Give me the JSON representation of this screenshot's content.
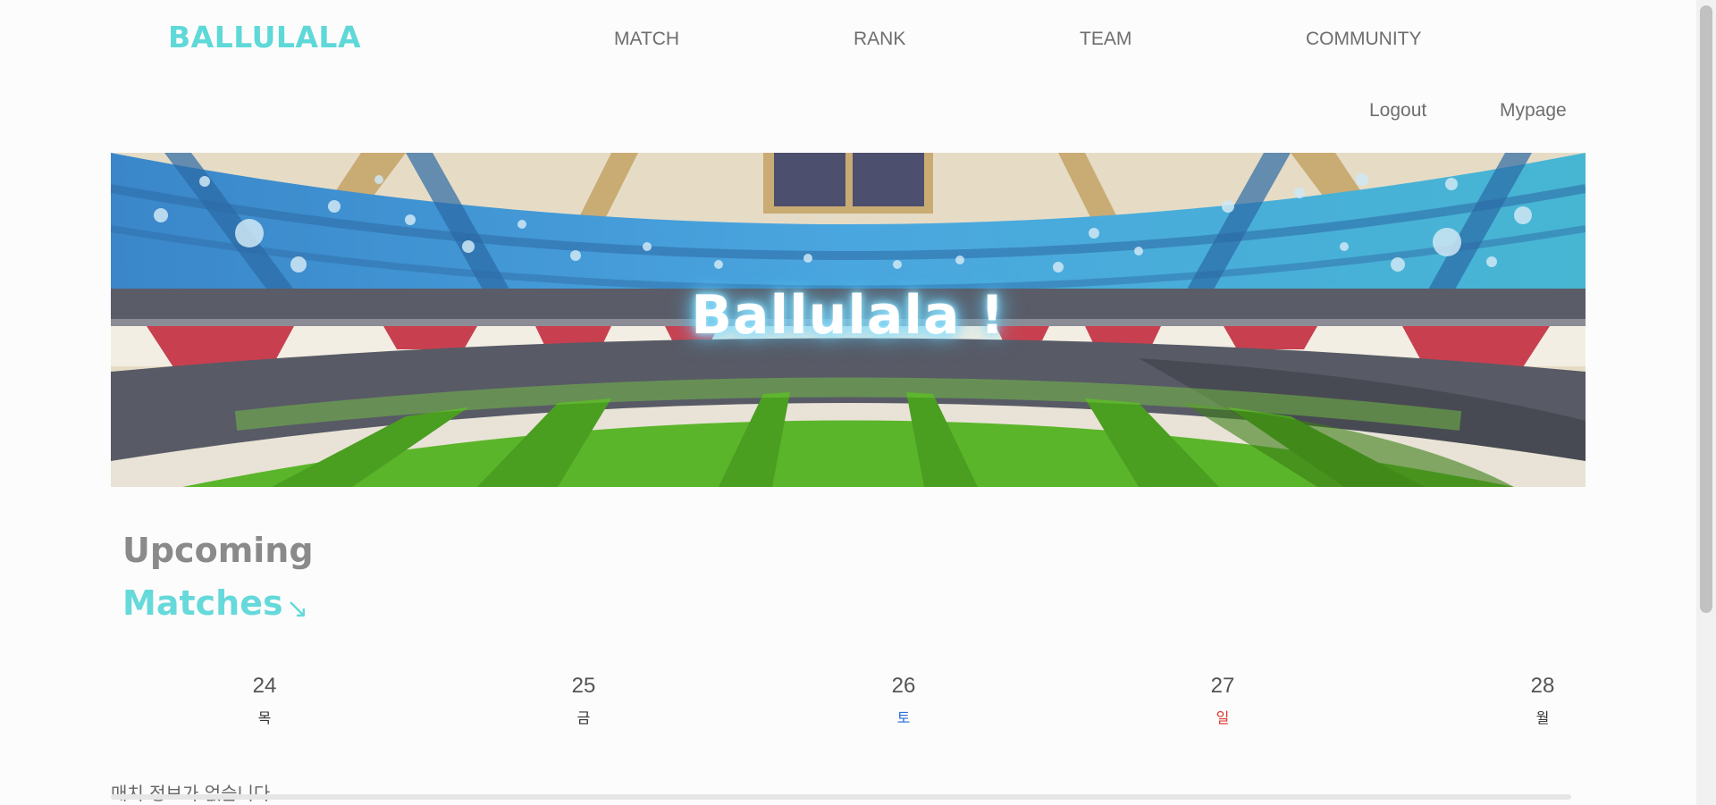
{
  "brand": "BALLULALA",
  "nav": [
    "MATCH",
    "RANK",
    "TEAM",
    "COMMUNITY"
  ],
  "user_links": {
    "logout": "Logout",
    "mypage": "Mypage"
  },
  "hero": {
    "title": "Ballulala !"
  },
  "section": {
    "title_line1": "Upcoming",
    "title_line2": "Matches",
    "arrow": "↘"
  },
  "calendar": [
    {
      "date": "24",
      "weekday": "목",
      "color": "#333333"
    },
    {
      "date": "25",
      "weekday": "금",
      "color": "#333333"
    },
    {
      "date": "26",
      "weekday": "토",
      "color": "#2a6fdb"
    },
    {
      "date": "27",
      "weekday": "일",
      "color": "#d9352f"
    },
    {
      "date": "28",
      "weekday": "월",
      "color": "#333333"
    }
  ],
  "match_message": "매치 정보가 없습니다.",
  "colors": {
    "accent": "#5fd8d8",
    "title_gray": "#8a8a8a"
  }
}
